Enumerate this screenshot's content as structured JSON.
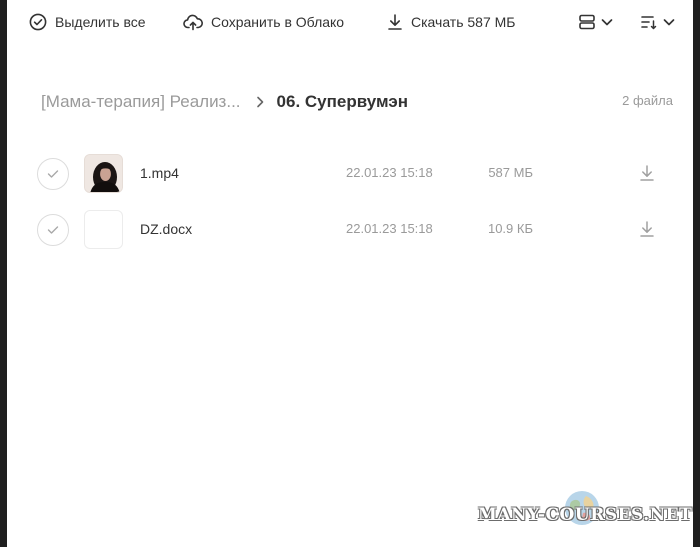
{
  "toolbar": {
    "select_all_label": "Выделить все",
    "save_to_cloud_label": "Сохранить в Облако",
    "download_label": "Скачать 587 МБ"
  },
  "breadcrumb": {
    "parent": "[Мама-терапия] Реализ...",
    "current": "06. Супервумэн"
  },
  "file_count": "2 файла",
  "files": [
    {
      "name": "1.mp4",
      "date": "22.01.23 15:18",
      "size": "587 МБ",
      "thumbnail": "portrait-photo"
    },
    {
      "name": "DZ.docx",
      "date": "22.01.23 15:18",
      "size": "10.9 КБ",
      "thumbnail": "blank-document"
    }
  ],
  "watermark": "MANY-COURSES.NET",
  "colors": {
    "background": "#ffffff",
    "frame": "#1f1f1f",
    "text_primary": "#333333",
    "text_secondary": "#9a9a9a",
    "border": "#dcdcdc"
  }
}
